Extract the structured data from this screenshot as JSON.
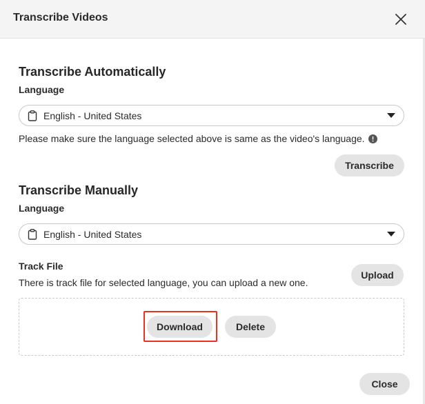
{
  "dialog": {
    "title": "Transcribe Videos",
    "close_icon": "close-icon"
  },
  "automatic": {
    "heading": "Transcribe Automatically",
    "language_label": "Language",
    "language_value": "English - United States",
    "note": "Please make sure the language selected above is same as the video's language.",
    "transcribe_button": "Transcribe"
  },
  "manual": {
    "heading": "Transcribe Manually",
    "language_label": "Language",
    "language_value": "English - United States",
    "track_file_label": "Track File",
    "track_file_note": "There is track file for selected language, you can upload a new one.",
    "upload_button": "Upload",
    "download_button": "Download",
    "delete_button": "Delete"
  },
  "footer": {
    "close_button": "Close"
  },
  "colors": {
    "header_bg": "#f4f4f4",
    "pill_bg": "#e4e4e4",
    "highlight": "#e8321f"
  }
}
